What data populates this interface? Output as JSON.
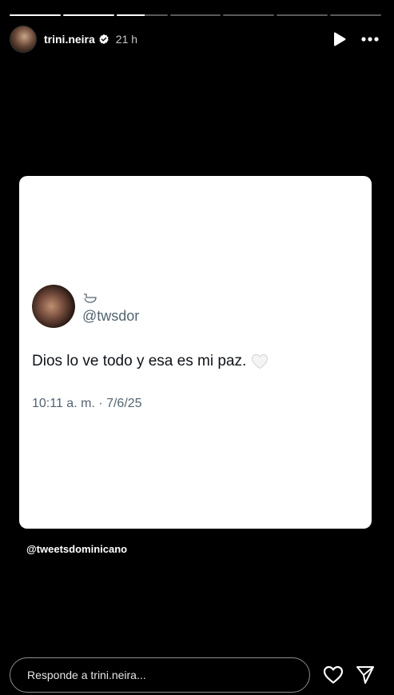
{
  "story": {
    "segments": [
      {
        "fill": 1.0
      },
      {
        "fill": 1.0
      },
      {
        "fill": 0.55
      },
      {
        "fill": 0.0
      },
      {
        "fill": 0.0
      },
      {
        "fill": 0.0
      },
      {
        "fill": 0.0
      }
    ]
  },
  "header": {
    "username": "trini.neira",
    "time": "21 h",
    "verified_icon": "verified-badge-icon",
    "play_icon": "play-icon",
    "more_icon": "more-icon"
  },
  "tweet": {
    "handle": "@twsdor",
    "text": "Dios lo ve todo y esa es mi paz.",
    "emoji": "white-heart",
    "meta": "10:11 a. m. · 7/6/25"
  },
  "credit": "@tweetsdominicano",
  "reply": {
    "placeholder": "Responde a trini.neira..."
  },
  "footer": {
    "like_icon": "heart-icon",
    "share_icon": "send-icon"
  }
}
